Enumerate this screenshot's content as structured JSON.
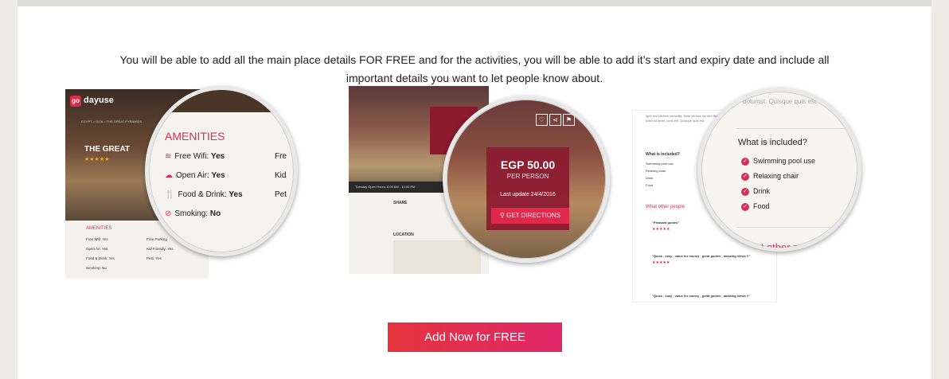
{
  "intro": {
    "line1": "You will be able to add all the main place details FOR FREE and for the activities, you will be able to add it’s start and expiry date and include all",
    "line2": "important details you want to let people know about."
  },
  "card_amenities": {
    "logo_mark": "go",
    "logo_text": "dayuse",
    "breadcrumb": "EGYPT > GIZA > THE GREAT PYRAMIDS",
    "title": "THE GREAT",
    "stars": "★★★★★",
    "section": "AMENITIES",
    "small_left": [
      "Free Wifi: Yes",
      "Open Air: Yes",
      "Food & Drink: Yes",
      "Smoking: No"
    ],
    "small_right": [
      "Free Parking",
      "Kid Friendly: Yes",
      "Pets: Yes"
    ],
    "zoom": {
      "heading": "AMENITIES",
      "rows": [
        {
          "label": "Free Wifi:",
          "value": "Yes",
          "icon": "wifi-icon",
          "glyph": "≋"
        },
        {
          "label": "Open Air:",
          "value": "Yes",
          "icon": "cloud-icon",
          "glyph": "☁"
        },
        {
          "label": "Food & Drink:",
          "value": "Yes",
          "icon": "fork-knife-icon",
          "glyph": "🍴"
        },
        {
          "label": "Smoking:",
          "value": "No",
          "icon": "no-smoking-icon",
          "glyph": "⊘"
        }
      ],
      "rows_right": [
        "Fre",
        "Kid",
        "Pet"
      ]
    }
  },
  "card_price": {
    "bar_text": "Tuesday   Open Hours: 8:00 AM - 10:00 PM",
    "share_label": "SHARE",
    "location_label": "LOCATION",
    "box_price": "EGP 50",
    "zoom": {
      "price": "EGP 50.00",
      "per": "PER PERSON",
      "update": "Last update 24/4/2016",
      "directions": "GET DIRECTIONS",
      "icons": [
        "heart-icon",
        "share-icon",
        "flag-icon"
      ]
    }
  },
  "card_included": {
    "body_text": "ique sed ultrices convallis. Nam ultrices lisi nec dignissim sodales. Lorem ipsum dolor sit amet, cons elit. Quisque quis est.",
    "what_included": "What is included?",
    "small_items": [
      "Swimming pool use",
      "Relaxing chair",
      "Drink",
      "Food"
    ],
    "other_people": "What other people",
    "review1": "\"Pleasant guides\"",
    "review2": "\"Quick , easy , value for money , great guides , amazing views !!\"",
    "review3": "\"Quick , easy , value for money , great guides , amazing views !!\"",
    "stars": "★★★★★",
    "zoom": {
      "top_text": "dolumst. Quisque quis est.",
      "heading": "What is included?",
      "items": [
        "Swimming pool use",
        "Relaxing chair",
        "Drink",
        "Food"
      ],
      "other": "What other peo"
    }
  },
  "cta": {
    "label": "Add Now for FREE"
  },
  "colors": {
    "accent": "#e0294a",
    "cta_start": "#e4333c",
    "cta_end": "#e0286a"
  }
}
